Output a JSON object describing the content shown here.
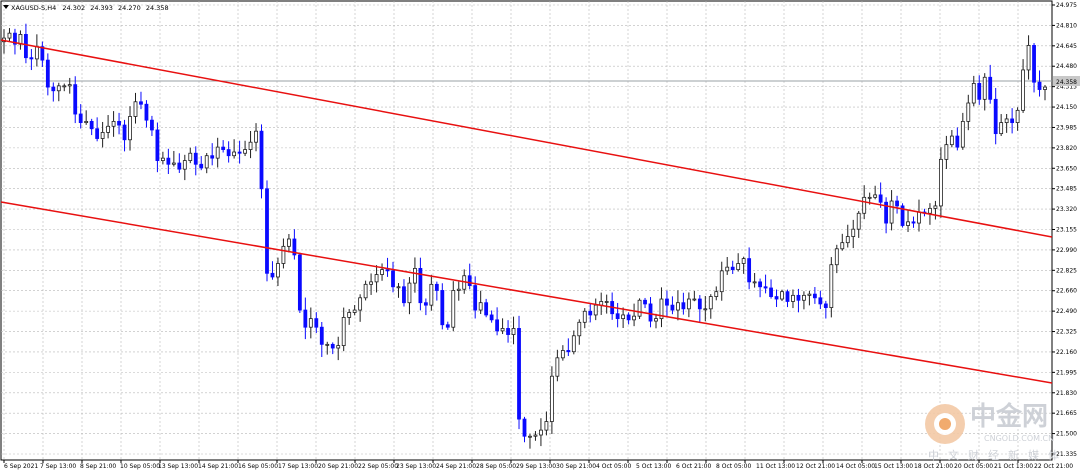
{
  "chart_data": {
    "type": "candlestick",
    "symbol": "XAGUSD-S,H4",
    "header_values": [
      "24.302",
      "24.393",
      "24.270",
      "24.358"
    ],
    "current_price": "24.358",
    "ylim": [
      21.335,
      25.0
    ],
    "y_ticks": [
      "24.975",
      "24.810",
      "24.645",
      "24.480",
      "24.315",
      "24.150",
      "23.985",
      "23.820",
      "23.650",
      "23.485",
      "23.320",
      "23.155",
      "22.990",
      "22.825",
      "22.660",
      "22.490",
      "22.325",
      "22.160",
      "21.995",
      "21.830",
      "21.665",
      "21.500",
      "21.335"
    ],
    "x_ticks": [
      "6 Sep 2021",
      "7 Sep 13:00",
      "8 Sep 21:00",
      "10 Sep 05:00",
      "13 Sep 13:00",
      "14 Sep 21:00",
      "16 Sep 05:00",
      "17 Sep 13:00",
      "20 Sep 21:00",
      "22 Sep 05:00",
      "23 Sep 13:00",
      "24 Sep 21:00",
      "28 Sep 05:00",
      "29 Sep 13:00",
      "30 Sep 21:00",
      "4 Oct 05:00",
      "5 Oct 13:00",
      "6 Oct 21:00",
      "8 Oct 05:00",
      "11 Oct 13:00",
      "12 Oct 21:00",
      "14 Oct 05:00",
      "15 Oct 13:00",
      "18 Oct 21:00",
      "20 Oct 05:00",
      "21 Oct 13:00",
      "22 Oct 21:00"
    ],
    "close": [
      24.73,
      24.77,
      24.68,
      24.76,
      24.57,
      24.56,
      24.66,
      24.55,
      24.33,
      24.3,
      24.34,
      24.34,
      24.35,
      24.11,
      24.04,
      24.05,
      23.99,
      23.91,
      23.96,
      24.01,
      24.05,
      24.02,
      23.9,
      24.09,
      24.21,
      24.19,
      24.06,
      23.98,
      23.73,
      23.75,
      23.7,
      23.71,
      23.66,
      23.73,
      23.79,
      23.7,
      23.67,
      23.77,
      23.75,
      23.84,
      23.82,
      23.77,
      23.8,
      23.79,
      23.82,
      23.88,
      23.97,
      23.5,
      22.81,
      22.78,
      22.89,
      23.03,
      23.09,
      22.96,
      22.51,
      22.37,
      22.44,
      22.37,
      22.23,
      22.23,
      22.2,
      22.22,
      22.45,
      22.49,
      22.51,
      22.61,
      22.72,
      22.74,
      22.8,
      22.84,
      22.83,
      22.7,
      22.7,
      22.57,
      22.73,
      22.85,
      22.57,
      22.55,
      22.72,
      22.67,
      22.39,
      22.37,
      22.67,
      22.68,
      22.79,
      22.71,
      22.51,
      22.57,
      22.47,
      22.43,
      22.34,
      22.36,
      22.31,
      22.36,
      21.62,
      21.48,
      21.48,
      21.49,
      21.53,
      21.6,
      21.97,
      22.12,
      22.18,
      22.17,
      22.3,
      22.41,
      22.5,
      22.47,
      22.55,
      22.58,
      22.58,
      22.48,
      22.44,
      22.47,
      22.43,
      22.46,
      22.59,
      22.56,
      22.42,
      22.44,
      22.6,
      22.55,
      22.51,
      22.57,
      22.52,
      22.6,
      22.6,
      22.52,
      22.52,
      22.62,
      22.66,
      22.83,
      22.86,
      22.84,
      22.89,
      22.93,
      22.74,
      22.74,
      22.7,
      22.69,
      22.62,
      22.6,
      22.66,
      22.58,
      22.63,
      22.59,
      22.63,
      22.64,
      22.61,
      22.56,
      22.53,
      22.88,
      23.01,
      23.06,
      23.11,
      23.17,
      23.3,
      23.43,
      23.43,
      23.45,
      23.39,
      23.22,
      23.4,
      23.36,
      23.2,
      23.23,
      23.22,
      23.31,
      23.3,
      23.34,
      23.36,
      23.74,
      23.86,
      23.93,
      23.84,
      24.05,
      24.2,
      24.36,
      24.23,
      24.41,
      24.23,
      23.95,
      24.04,
      24.07,
      24.04,
      24.14,
      24.47,
      24.67,
      24.37,
      24.31,
      24.33
    ]
  }
}
